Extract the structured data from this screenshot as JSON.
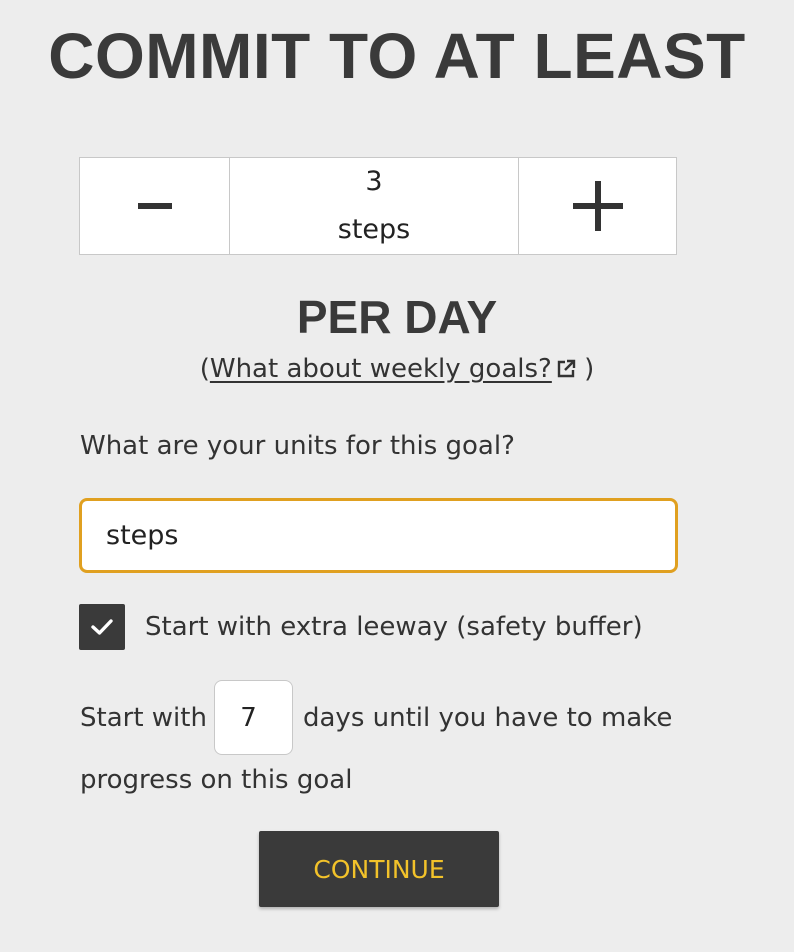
{
  "header": {
    "title": "COMMIT TO AT LEAST"
  },
  "stepper": {
    "decrement_icon": "minus-icon",
    "increment_icon": "plus-icon",
    "value": "3",
    "unit": "steps"
  },
  "period": {
    "label": "PER DAY",
    "weekly_prefix": "(",
    "weekly_link": "What about weekly goals?",
    "weekly_suffix": ")",
    "link_icon": "external-link-icon"
  },
  "units": {
    "label": "What are your units for this goal?",
    "value": "steps"
  },
  "leeway": {
    "checked": true,
    "label": "Start with extra leeway (safety buffer)"
  },
  "buffer_days": {
    "prefix": "Start with",
    "value": "7",
    "suffix_line1": "days until you have to make",
    "suffix_line2": "progress on this goal"
  },
  "actions": {
    "continue_label": "CONTINUE"
  },
  "colors": {
    "background": "#ededed",
    "dark": "#3a3a3a",
    "focus_border": "#e0a020",
    "button_text": "#f2c22a"
  }
}
